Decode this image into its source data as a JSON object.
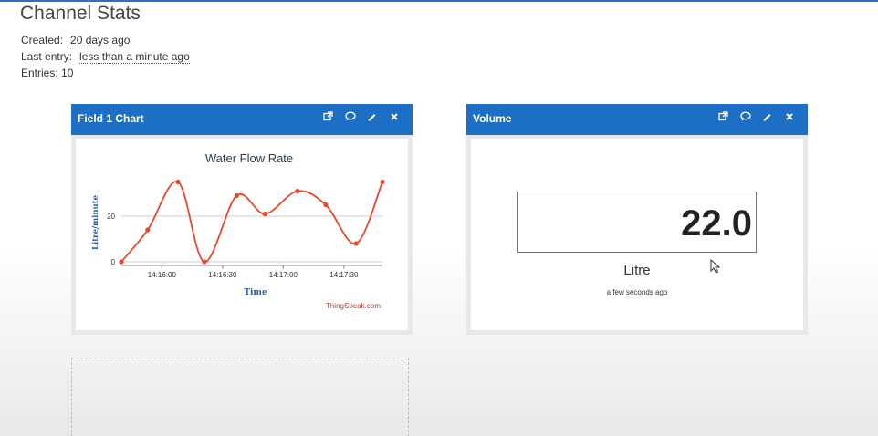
{
  "page": {
    "title": "Channel Stats"
  },
  "stats": {
    "created_label": "Created:",
    "created_value": "20 days ago",
    "last_entry_label": "Last entry:",
    "last_entry_value": "less than a minute ago",
    "entries_label": "Entries:",
    "entries_value": "10"
  },
  "panels": {
    "chart": {
      "title": "Field 1 Chart",
      "icons": [
        "external-link-icon",
        "comment-icon",
        "pencil-icon",
        "close-icon"
      ]
    },
    "volume": {
      "title": "Volume",
      "value": "22.0",
      "unit": "Litre",
      "timestamp": "a few seconds ago",
      "icons": [
        "external-link-icon",
        "comment-icon",
        "pencil-icon",
        "close-icon"
      ]
    }
  },
  "colors": {
    "header": "#1c6fc4",
    "line": "#e8492b"
  },
  "chart_data": {
    "type": "line",
    "title": "Water Flow Rate",
    "xlabel": "Time",
    "ylabel": "Litre/minute",
    "credit": "ThingSpeak.com",
    "x_ticks": [
      "14:16:00",
      "14:16:30",
      "14:17:00",
      "14:17:30"
    ],
    "y_ticks": [
      "0",
      "20"
    ],
    "ylim": [
      0,
      40
    ],
    "grid": true,
    "series": [
      {
        "x": [
          "14:15:40",
          "14:15:53",
          "14:16:08",
          "14:16:21",
          "14:16:37",
          "14:16:51",
          "14:17:07",
          "14:17:21",
          "14:17:36",
          "14:17:49"
        ],
        "values": [
          0,
          14,
          35,
          0,
          29,
          21,
          31,
          25,
          8,
          35
        ]
      }
    ]
  }
}
